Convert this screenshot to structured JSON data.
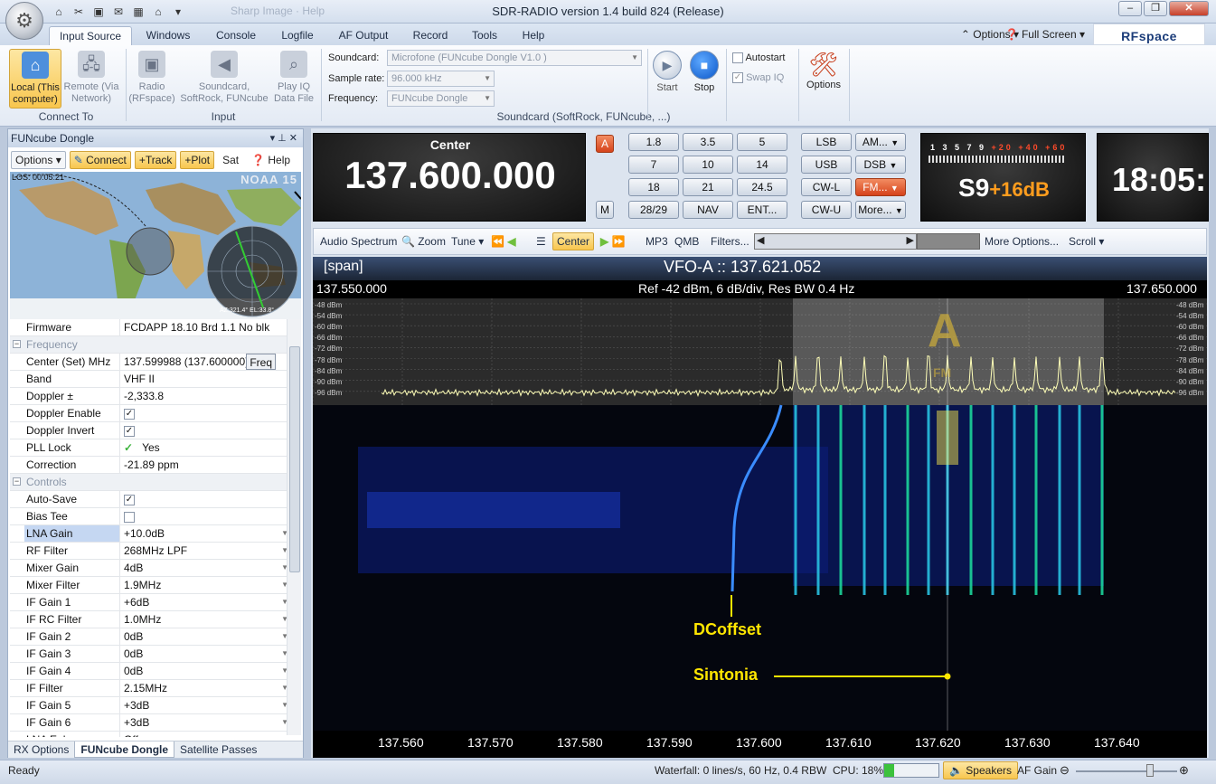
{
  "window": {
    "title": "SDR-RADIO version 1.4 build 824 (Release)",
    "ghost_title": "Sharp Image · Help",
    "controls": [
      "–",
      "❐",
      "✕"
    ]
  },
  "quick_access": [
    "⌂",
    "✂",
    "▣",
    "✉",
    "▦",
    "⌂",
    "▾"
  ],
  "menu_tabs": [
    "Input Source",
    "Windows",
    "Console",
    "Logfile",
    "AF Output",
    "Record",
    "Tools",
    "Help"
  ],
  "menu_right": {
    "options": "Options",
    "full_screen": "Full Screen",
    "logo": "RFspace"
  },
  "ribbon": {
    "connect_to": {
      "label": "Connect To",
      "local": "Local (This computer)",
      "remote": "Remote (Via Network)"
    },
    "input": {
      "label": "Input",
      "radio": "Radio (RFspace)",
      "soundcard": "Soundcard, SoftRock, FUNcube",
      "playiq": "Play IQ Data File"
    },
    "soundcard_group": {
      "label": "Soundcard (SoftRock, FUNcube, ...)",
      "soundcard_label": "Soundcard:",
      "soundcard_value": "Microfone (FUNcube Dongle V1.0 )",
      "samplerate_label": "Sample rate:",
      "samplerate_value": "96.000 kHz",
      "frequency_label": "Frequency:",
      "frequency_value": "FUNcube Dongle"
    },
    "start": "Start",
    "stop": "Stop",
    "autostart": "Autostart",
    "swapiq": "Swap IQ",
    "options": "Options"
  },
  "left_panel": {
    "title": "FUNcube Dongle",
    "toolbar": {
      "options": "Options",
      "connect": "Connect",
      "track": "+Track",
      "plot": "+Plot",
      "sat": "Sat",
      "help": "Help"
    },
    "map": {
      "satellite": "NOAA 15",
      "los": "LOS: 00:05:21",
      "azel": "AZ:321.4°  EL:33.8°"
    },
    "properties": [
      {
        "type": "row",
        "name": "Firmware",
        "value": "FCDAPP 18.10 Brd 1.1 No blk"
      },
      {
        "type": "cat",
        "name": "Frequency"
      },
      {
        "type": "row",
        "name": "Center (Set) MHz",
        "value": "137.599988 (137.600000)",
        "extra": "Freq"
      },
      {
        "type": "row",
        "name": "Band",
        "value": "VHF II"
      },
      {
        "type": "row",
        "name": "Doppler ±",
        "value": "-2,333.8"
      },
      {
        "type": "row",
        "name": "Doppler Enable",
        "check": true
      },
      {
        "type": "row",
        "name": "Doppler Invert",
        "check": true
      },
      {
        "type": "row",
        "name": "PLL Lock",
        "value": "Yes",
        "tick": true
      },
      {
        "type": "row",
        "name": "Correction",
        "value": "-21.89 ppm"
      },
      {
        "type": "cat",
        "name": "Controls"
      },
      {
        "type": "row",
        "name": "Auto-Save",
        "check": true
      },
      {
        "type": "row",
        "name": "Bias Tee",
        "check": false
      },
      {
        "type": "row",
        "name": "LNA Gain",
        "value": "+10.0dB",
        "dd": true,
        "selected": true
      },
      {
        "type": "row",
        "name": "RF Filter",
        "value": "268MHz LPF",
        "dd": true
      },
      {
        "type": "row",
        "name": "Mixer Gain",
        "value": "4dB",
        "dd": true
      },
      {
        "type": "row",
        "name": "Mixer Filter",
        "value": "1.9MHz",
        "dd": true
      },
      {
        "type": "row",
        "name": "IF Gain 1",
        "value": "+6dB",
        "dd": true
      },
      {
        "type": "row",
        "name": "IF RC Filter",
        "value": "1.0MHz",
        "dd": true
      },
      {
        "type": "row",
        "name": "IF Gain 2",
        "value": "0dB",
        "dd": true
      },
      {
        "type": "row",
        "name": "IF Gain 3",
        "value": "0dB",
        "dd": true
      },
      {
        "type": "row",
        "name": "IF Gain 4",
        "value": "0dB",
        "dd": true
      },
      {
        "type": "row",
        "name": "IF Filter",
        "value": "2.15MHz",
        "dd": true
      },
      {
        "type": "row",
        "name": "IF Gain 5",
        "value": "+3dB",
        "dd": true
      },
      {
        "type": "row",
        "name": "IF Gain 6",
        "value": "+3dB",
        "dd": true
      },
      {
        "type": "row",
        "name": "LNA Enhance",
        "value": "Off",
        "dd": true
      }
    ],
    "tabs": [
      "RX Options",
      "FUNcube Dongle",
      "Satellite Passes"
    ]
  },
  "center": {
    "label": "Center",
    "frequency": "137.600.000"
  },
  "freq_buttons": {
    "a": "A",
    "m": "M",
    "bands": [
      "1.8",
      "3.5",
      "5",
      "7",
      "10",
      "14",
      "18",
      "21",
      "24.5",
      "28/29",
      "NAV",
      "ENT..."
    ],
    "modes": [
      "LSB",
      "AM...",
      "USB",
      "DSB",
      "CW-L",
      "FM...",
      "CW-U",
      "More..."
    ]
  },
  "smeter": {
    "scale": "1 3 5 7 9",
    "scale_plus": "+20 +40 +60",
    "reading": "S9",
    "plus": "+16dB"
  },
  "clock": "18:05:",
  "spectrum_toolbar": [
    "Audio Spectrum",
    "Zoom",
    "Tune",
    "Center",
    "MP3",
    "QMB",
    "Filters...",
    "More Options...",
    "Scroll"
  ],
  "spectrum": {
    "span": "[span]",
    "vfo": "VFO-A  ::  137.621.052",
    "left_freq": "137.550.000",
    "right_freq": "137.650.000",
    "ref": "Ref -42 dBm,  6 dB/div,  Res BW 0.4 Hz",
    "db_labels": [
      "-48 dBm",
      "-54 dBm",
      "-60 dBm",
      "-66 dBm",
      "-72 dBm",
      "-78 dBm",
      "-84 dBm",
      "-90 dBm",
      "-96 dBm"
    ],
    "x_ticks": [
      "137.560",
      "137.570",
      "137.580",
      "137.590",
      "137.600",
      "137.610",
      "137.620",
      "137.630",
      "137.640"
    ],
    "vfo_letter": "A",
    "vfo_mode": "FM",
    "dcoffset": "DCoffset",
    "sintonia": "Sintonia"
  },
  "status": {
    "ready": "Ready",
    "waterfall": "Waterfall: 0 lines/s, 60 Hz, 0.4 RBW",
    "cpu": "CPU: 18%",
    "speakers": "Speakers",
    "afgain": "AF Gain"
  },
  "colors": {
    "accent": "#f8c64e",
    "red": "#d6431b",
    "annotation": "#ffe600"
  }
}
